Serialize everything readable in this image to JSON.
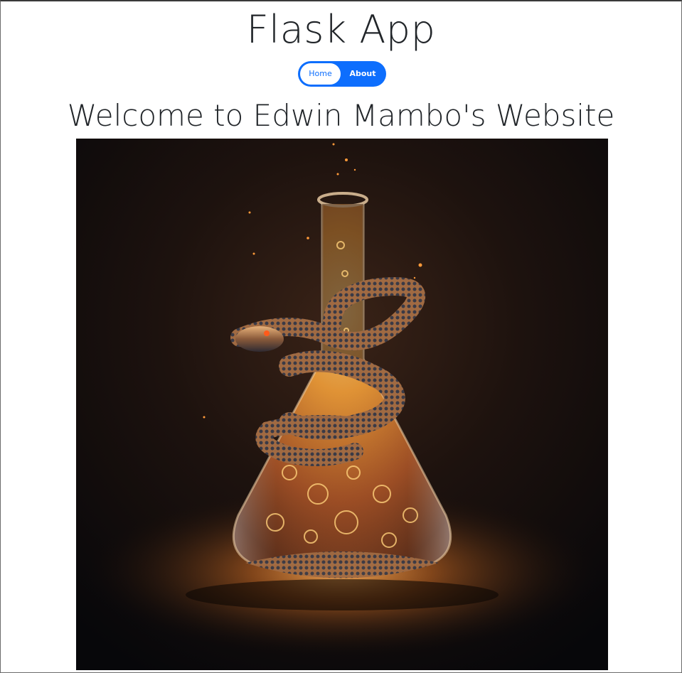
{
  "header": {
    "title": "Flask App"
  },
  "nav": {
    "items": [
      {
        "label": "Home",
        "active": true
      },
      {
        "label": "About",
        "active": false
      }
    ],
    "accent_color": "#0d6efd"
  },
  "main": {
    "heading": "Welcome to Edwin Mambo's Website",
    "image": {
      "subject": "snake-coiled-around-glowing-laboratory-flask"
    }
  }
}
